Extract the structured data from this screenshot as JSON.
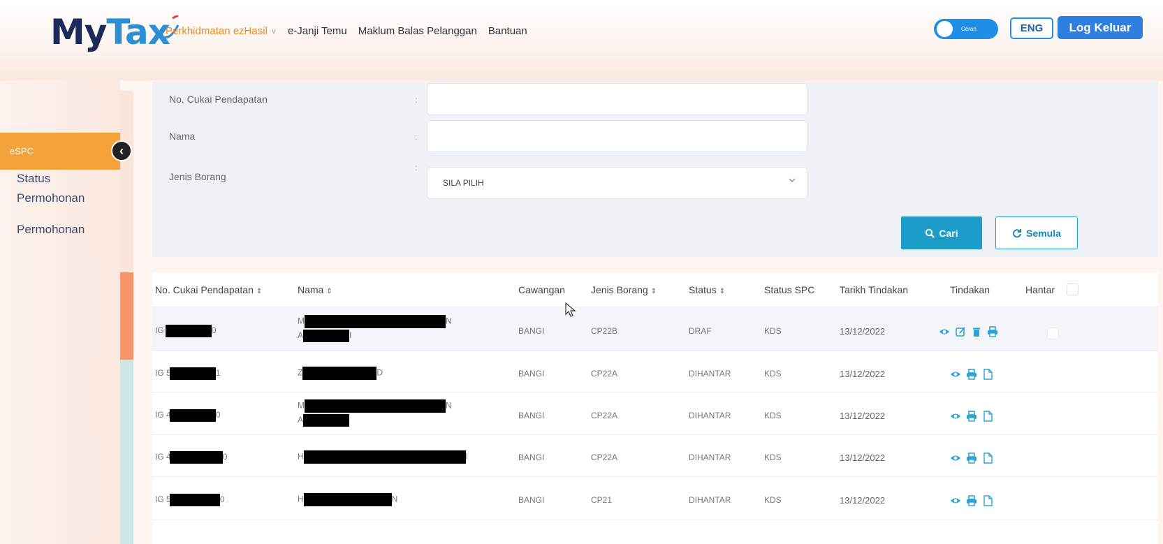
{
  "brand": {
    "logo_my": "My",
    "logo_tax": "Tax"
  },
  "nav": {
    "items": [
      {
        "label": "Perkhidmatan ezHasil",
        "active": true,
        "icon": "chevron-down-icon"
      },
      {
        "label": "e-Janji Temu"
      },
      {
        "label": "Maklum Balas Pelanggan"
      },
      {
        "label": "Bantuan"
      }
    ]
  },
  "header_controls": {
    "toggle_label": "Cerah",
    "lang_button": "ENG",
    "logout_button": "Log Keluar"
  },
  "sidebar": {
    "section": "eSPC",
    "collapse_icon": "chevron-left-icon",
    "items": [
      {
        "label_line1": "Status",
        "label_line2": "Permohonan"
      },
      {
        "label_line1": "Permohonan",
        "label_line2": ""
      }
    ]
  },
  "search": {
    "income_tax_label": "No. Cukai Pendapatan",
    "income_tax_value": "",
    "name_label": "Nama",
    "name_value": "",
    "form_type_label": "Jenis Borang",
    "form_type_selected": "SILA PILIH",
    "colon": ":",
    "search_button": "Cari",
    "reset_button": "Semula"
  },
  "table": {
    "columns": [
      {
        "label": "No. Cukai Pendapatan",
        "sortable": true
      },
      {
        "label": "Nama",
        "sortable": true
      },
      {
        "label": "Cawangan",
        "sortable": false
      },
      {
        "label": "Jenis Borang",
        "sortable": true
      },
      {
        "label": "Status",
        "sortable": true
      },
      {
        "label": "Status SPC",
        "sortable": false
      },
      {
        "label": "Tarikh Tindakan",
        "sortable": false
      },
      {
        "label": "Tindakan",
        "sortable": false
      },
      {
        "label": "Hantar",
        "sortable": false
      }
    ],
    "sort_glyph": "⇕",
    "rows": [
      {
        "tax_prefix": "IG 4",
        "tax_suffix": "0",
        "name_a": "M",
        "name_b": "N",
        "name_c": "A",
        "name_d": "I",
        "branch": "BANGI",
        "form": "CP22B",
        "status": "DRAF",
        "spc": "KDS",
        "date": "13/12/2022",
        "actions": [
          "eye-icon",
          "edit-icon",
          "trash-icon",
          "print-icon"
        ],
        "has_checkbox": true
      },
      {
        "tax_prefix": "IG 5",
        "tax_suffix": "1",
        "name_a": "Z",
        "name_b": "D",
        "name_c": "",
        "name_d": "",
        "branch": "BANGI",
        "form": "CP22A",
        "status": "DIHANTAR",
        "spc": "KDS",
        "date": "13/12/2022",
        "actions": [
          "eye-icon",
          "print-icon",
          "document-icon"
        ],
        "has_checkbox": false
      },
      {
        "tax_prefix": "IG 4",
        "tax_suffix": "0",
        "name_a": "M",
        "name_b": "N",
        "name_c": "A",
        "name_d": "",
        "branch": "BANGI",
        "form": "CP22A",
        "status": "DIHANTAR",
        "spc": "KDS",
        "date": "13/12/2022",
        "actions": [
          "eye-icon",
          "print-icon",
          "document-icon"
        ],
        "has_checkbox": false
      },
      {
        "tax_prefix": "IG 4",
        "tax_suffix": "0",
        "name_a": "H",
        "name_b": "I",
        "name_c": "",
        "name_d": "",
        "branch": "BANGI",
        "form": "CP22A",
        "status": "DIHANTAR",
        "spc": "KDS",
        "date": "13/12/2022",
        "actions": [
          "eye-icon",
          "print-icon",
          "document-icon"
        ],
        "has_checkbox": false
      },
      {
        "tax_prefix": "IG 5",
        "tax_suffix": "0",
        "name_a": "H",
        "name_b": "N",
        "name_c": "",
        "name_d": "",
        "branch": "BANGI",
        "form": "CP21",
        "status": "DIHANTAR",
        "spc": "KDS",
        "date": "13/12/2022",
        "actions": [
          "eye-icon",
          "print-icon",
          "document-icon"
        ],
        "has_checkbox": false
      }
    ]
  },
  "colors": {
    "accent_orange": "#f4a23a",
    "primary_blue": "#2e7fe0",
    "teal_button": "#1b9cc9",
    "nav_active": "#f08a24",
    "icon_blue": "#2aa3d6"
  }
}
